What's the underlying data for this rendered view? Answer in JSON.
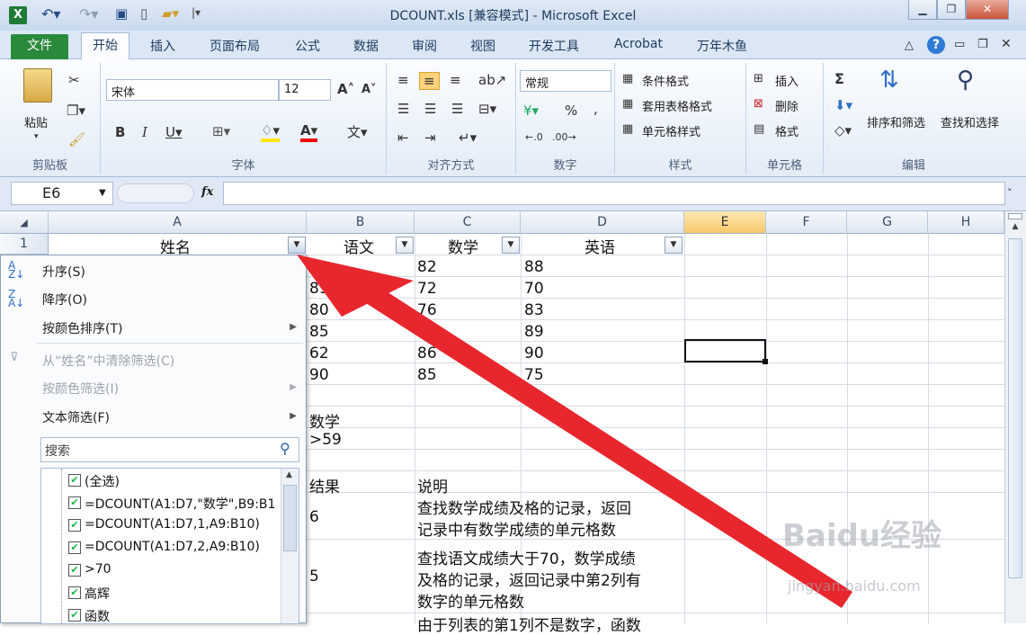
{
  "window": {
    "title": "DCOUNT.xls [兼容模式] - Microsoft Excel"
  },
  "tabs": {
    "file": "文件",
    "items": [
      "开始",
      "插入",
      "页面布局",
      "公式",
      "数据",
      "审阅",
      "视图",
      "开发工具",
      "Acrobat",
      "万年木鱼"
    ]
  },
  "ribbon": {
    "clipboard": {
      "paste": "粘贴",
      "label": "剪贴板"
    },
    "font": {
      "name": "宋体",
      "size": "12",
      "label": "字体"
    },
    "align": {
      "label": "对齐方式"
    },
    "number": {
      "format": "常规",
      "pct": "%",
      "label": "数字"
    },
    "styles": {
      "cond": "条件格式",
      "table": "套用表格格式",
      "cell": "单元格样式",
      "label": "样式"
    },
    "cells": {
      "insert": "插入",
      "delete": "删除",
      "format": "格式",
      "label": "单元格"
    },
    "edit": {
      "sum": "Σ",
      "sort": "排序和筛选",
      "find": "查找和选择",
      "label": "编辑"
    }
  },
  "namebox": "E6",
  "fx": "fx",
  "columns": [
    "A",
    "B",
    "C",
    "D",
    "E",
    "F",
    "G",
    "H"
  ],
  "row1": {
    "num": "1",
    "a": "姓名",
    "b": "语文",
    "c": "数学",
    "d": "英语"
  },
  "cells": {
    "c2": "82",
    "d2": "88",
    "b3": "89",
    "c3": "72",
    "d3": "70",
    "b4": "80",
    "c4": "76",
    "d4": "83",
    "b5": "85",
    "c5": "75",
    "d5": "89",
    "b6": "62",
    "c6": "86",
    "d6": "90",
    "b7": "90",
    "c7": "85",
    "d7": "75",
    "b9": "数学",
    "b10": ">59",
    "b12": "结果",
    "c12": "说明",
    "b13": "6",
    "c13a": "查找数学成绩及格的记录，返回",
    "c13b": "记录中有数学成绩的单元格数",
    "b14": "5",
    "c14a": "查找语文成绩大于70，数学成绩",
    "c14b": "及格的记录，返回记录中第2列有",
    "c14c": "数字的单元格数",
    "c15": "由于列表的第1列不是数字，函数"
  },
  "menu": {
    "asc": "升序(S)",
    "desc": "降序(O)",
    "bycolor": "按颜色排序(T)",
    "clear": "从“姓名”中清除筛选(C)",
    "colorfilter": "按颜色筛选(I)",
    "textfilter": "文本筛选(F)",
    "search_placeholder": "搜索",
    "items": [
      "(全选)",
      "=DCOUNT(A1:D7,\"数学\",B9:B1",
      "=DCOUNT(A1:D7,1,A9:B10)",
      "=DCOUNT(A1:D7,2,A9:B10)",
      ">70",
      "高辉",
      "函数"
    ]
  },
  "watermark": {
    "main": "Baidu经验",
    "sub": "jingyan.baidu.com"
  }
}
